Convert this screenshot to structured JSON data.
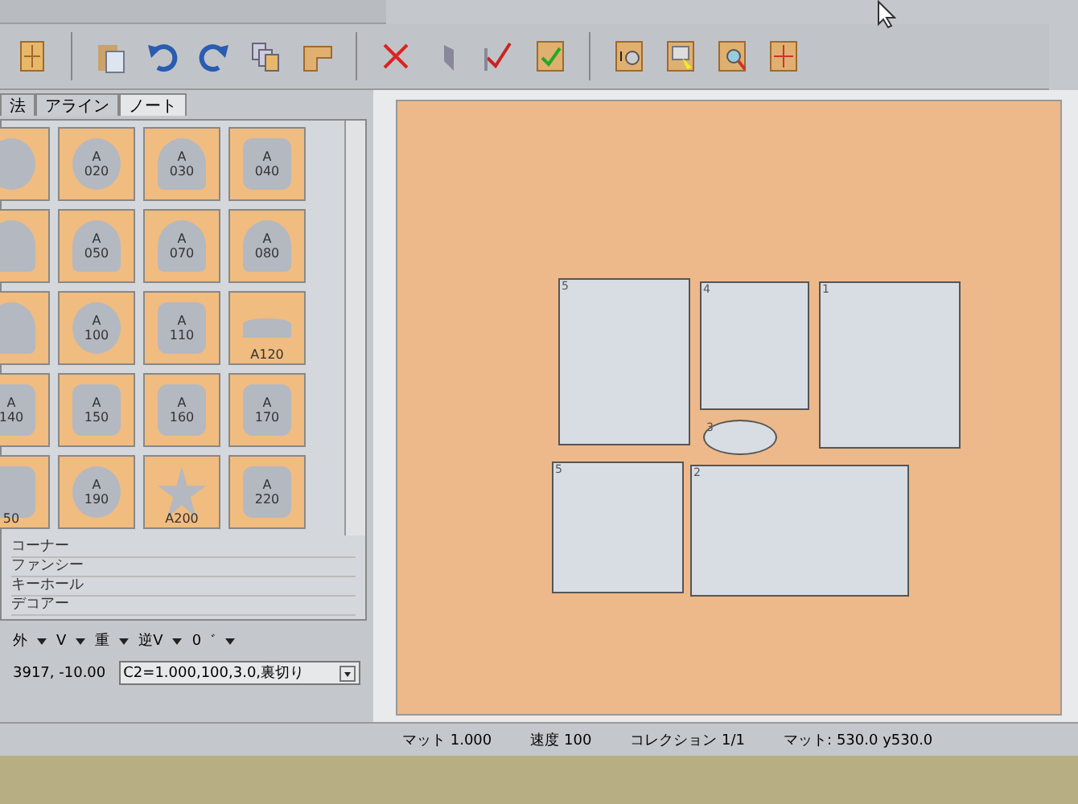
{
  "tabs": [
    {
      "label": "法",
      "selected": false
    },
    {
      "label": "アライン",
      "selected": false
    },
    {
      "label": "ノート",
      "selected": true
    }
  ],
  "toolbar": [
    {
      "kind": "frame"
    },
    {
      "kind": "paste"
    },
    {
      "kind": "undo"
    },
    {
      "kind": "redo"
    },
    {
      "kind": "stack"
    },
    {
      "kind": "corner"
    },
    {
      "kind": "delete"
    },
    {
      "kind": "flag"
    },
    {
      "kind": "check"
    },
    {
      "kind": "checkframe"
    },
    {
      "kind": "numbered"
    },
    {
      "kind": "pointer"
    },
    {
      "kind": "zoom"
    },
    {
      "kind": "grid"
    }
  ],
  "shapes": [
    {
      "kind": "oval"
    },
    {
      "kind": "oval",
      "top": "A",
      "number": "020"
    },
    {
      "kind": "arch",
      "top": "A",
      "number": "030"
    },
    {
      "kind": "rounded",
      "top": "A",
      "number": "040"
    },
    {
      "kind": "arch"
    },
    {
      "kind": "arch",
      "top": "A",
      "number": "050"
    },
    {
      "kind": "arch",
      "top": "A",
      "number": "070"
    },
    {
      "kind": "arch",
      "top": "A",
      "number": "080"
    },
    {
      "kind": "arch"
    },
    {
      "kind": "oval",
      "top": "A",
      "number": "100"
    },
    {
      "kind": "rounded",
      "top": "A",
      "number": "110"
    },
    {
      "kind": "crescent",
      "number": "A120"
    },
    {
      "kind": "rounded",
      "top": "A",
      "number": "140"
    },
    {
      "kind": "rounded",
      "top": "A",
      "number": "150"
    },
    {
      "kind": "rounded",
      "top": "A",
      "number": "160"
    },
    {
      "kind": "rounded",
      "top": "A",
      "number": "170"
    },
    {
      "kind": "rounded",
      "number": "50"
    },
    {
      "kind": "oval",
      "top": "A",
      "number": "190"
    },
    {
      "kind": "star",
      "number": "A200"
    },
    {
      "kind": "rounded",
      "top": "A",
      "number": "220"
    }
  ],
  "categories": [
    "コーナー",
    "ファンシー",
    "キーホール",
    "デコアー"
  ],
  "options": [
    "外",
    "V",
    "重",
    "逆V",
    "0゛"
  ],
  "coordinates": "3917, -10.00",
  "cut_setting": "C2=1.000,100,3.0,裏切り",
  "mat": {
    "openings": [
      {
        "number": "5",
        "kind": "rect"
      },
      {
        "number": "4",
        "kind": "rect"
      },
      {
        "number": "1",
        "kind": "rect"
      },
      {
        "number": "3",
        "kind": "oval"
      },
      {
        "number": "5",
        "kind": "rect"
      },
      {
        "number": "2",
        "kind": "rect"
      }
    ]
  },
  "status_bar": [
    "マット 1.000",
    "速度 100",
    "コレクション 1/1",
    "マット: 530.0 y530.0"
  ]
}
